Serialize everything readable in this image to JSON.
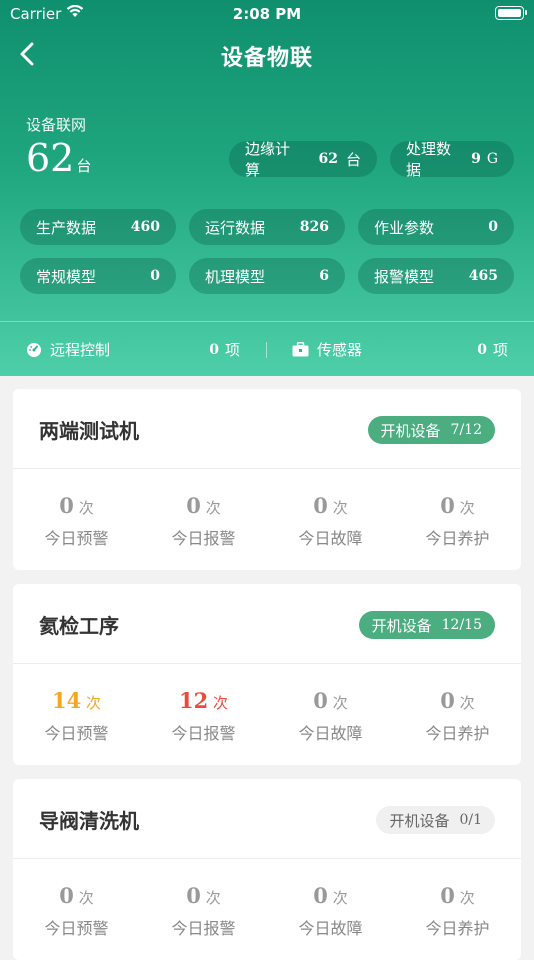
{
  "status_bar": {
    "carrier": "Carrier",
    "time": "2:08 PM"
  },
  "nav": {
    "title": "设备物联"
  },
  "network": {
    "label": "设备联网",
    "count": "62",
    "unit": "台"
  },
  "summary_pills": [
    {
      "label": "边缘计算",
      "value": "62",
      "unit": "台"
    },
    {
      "label": "处理数据",
      "value": "9",
      "unit": "G"
    }
  ],
  "stats": [
    {
      "label": "生产数据",
      "value": "460"
    },
    {
      "label": "运行数据",
      "value": "826"
    },
    {
      "label": "作业参数",
      "value": "0"
    },
    {
      "label": "常规模型",
      "value": "0"
    },
    {
      "label": "机理模型",
      "value": "6"
    },
    {
      "label": "报警模型",
      "value": "465"
    }
  ],
  "strip": [
    {
      "label": "远程控制",
      "value": "0",
      "unit": "项",
      "icon": "gauge-icon"
    },
    {
      "label": "传感器",
      "value": "0",
      "unit": "项",
      "icon": "toolbox-icon"
    }
  ],
  "colors": {
    "warning": "#f5a623",
    "alarm": "#e94b3c",
    "muted": "#999999",
    "on": "#4cae80"
  },
  "devices": [
    {
      "name": "两端测试机",
      "badge_label": "开机设备",
      "badge_value": "7/12",
      "badge_state": "on",
      "metrics": [
        {
          "value": "0",
          "unit": "次",
          "label": "今日预警"
        },
        {
          "value": "0",
          "unit": "次",
          "label": "今日报警"
        },
        {
          "value": "0",
          "unit": "次",
          "label": "今日故障"
        },
        {
          "value": "0",
          "unit": "次",
          "label": "今日养护"
        }
      ]
    },
    {
      "name": "氦检工序",
      "badge_label": "开机设备",
      "badge_value": "12/15",
      "badge_state": "on",
      "metrics": [
        {
          "value": "14",
          "unit": "次",
          "label": "今日预警"
        },
        {
          "value": "12",
          "unit": "次",
          "label": "今日报警"
        },
        {
          "value": "0",
          "unit": "次",
          "label": "今日故障"
        },
        {
          "value": "0",
          "unit": "次",
          "label": "今日养护"
        }
      ]
    },
    {
      "name": "导阀清洗机",
      "badge_label": "开机设备",
      "badge_value": "0/1",
      "badge_state": "off",
      "metrics": [
        {
          "value": "0",
          "unit": "次",
          "label": "今日预警"
        },
        {
          "value": "0",
          "unit": "次",
          "label": "今日报警"
        },
        {
          "value": "0",
          "unit": "次",
          "label": "今日故障"
        },
        {
          "value": "0",
          "unit": "次",
          "label": "今日养护"
        }
      ]
    }
  ]
}
